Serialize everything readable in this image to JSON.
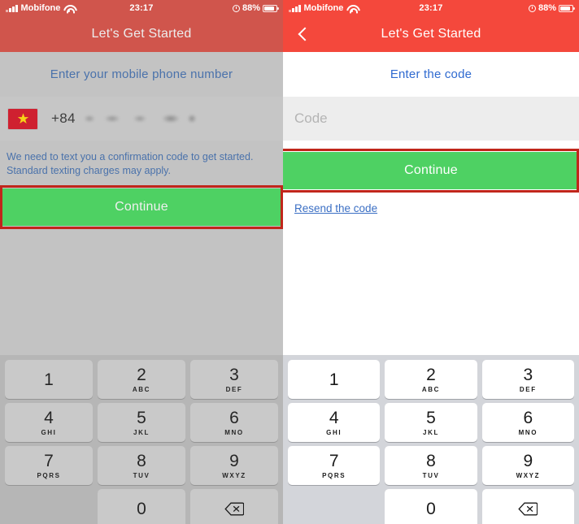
{
  "statusbar": {
    "carrier": "Mobifone",
    "time": "23:17",
    "battery_pct": "88%",
    "wifi_icon": "wifi-icon",
    "signal_icon": "signal-bars-icon",
    "alarm_icon": "alarm-clock-icon",
    "battery_icon": "battery-icon"
  },
  "left_screen": {
    "nav_title": "Let's Get Started",
    "prompt": "Enter your mobile phone number",
    "country_flag": "vietnam-flag-icon",
    "country_code": "+84",
    "phone_number_masked": "",
    "helper_text": "We need to text you a confirmation code to get started. Standard texting charges may apply.",
    "continue_label": "Continue"
  },
  "right_screen": {
    "nav_title": "Let's Get Started",
    "back_icon": "chevron-left-icon",
    "prompt": "Enter the code",
    "code_placeholder": "Code",
    "code_value": "",
    "continue_label": "Continue",
    "resend_label": "Resend the code"
  },
  "keypad": {
    "rows": [
      [
        {
          "digit": "1",
          "letters": ""
        },
        {
          "digit": "2",
          "letters": "ABC"
        },
        {
          "digit": "3",
          "letters": "DEF"
        }
      ],
      [
        {
          "digit": "4",
          "letters": "GHI"
        },
        {
          "digit": "5",
          "letters": "JKL"
        },
        {
          "digit": "6",
          "letters": "MNO"
        }
      ],
      [
        {
          "digit": "7",
          "letters": "PQRS"
        },
        {
          "digit": "8",
          "letters": "TUV"
        },
        {
          "digit": "9",
          "letters": "WXYZ"
        }
      ],
      [
        {
          "digit": "",
          "letters": "",
          "blank": true
        },
        {
          "digit": "0",
          "letters": ""
        },
        {
          "digit": "",
          "letters": "",
          "delete": true,
          "icon": "backspace-icon"
        }
      ]
    ]
  },
  "colors": {
    "nav_red": "#f4483c",
    "nav_red_dim": "#d0554c",
    "continue_green": "#4ed163",
    "annotation_red": "#c0261b",
    "link_blue": "#3b6fc4",
    "prompt_blue": "#2f6ad0",
    "flag_red": "#cf2030",
    "flag_star_yellow": "#f7d117",
    "dim_overlay_grey": "#c3c3c3",
    "keypad_bg_right": "#d3d5da",
    "keypad_bg_left": "#b6b6b6",
    "field_grey": "#ededed"
  }
}
